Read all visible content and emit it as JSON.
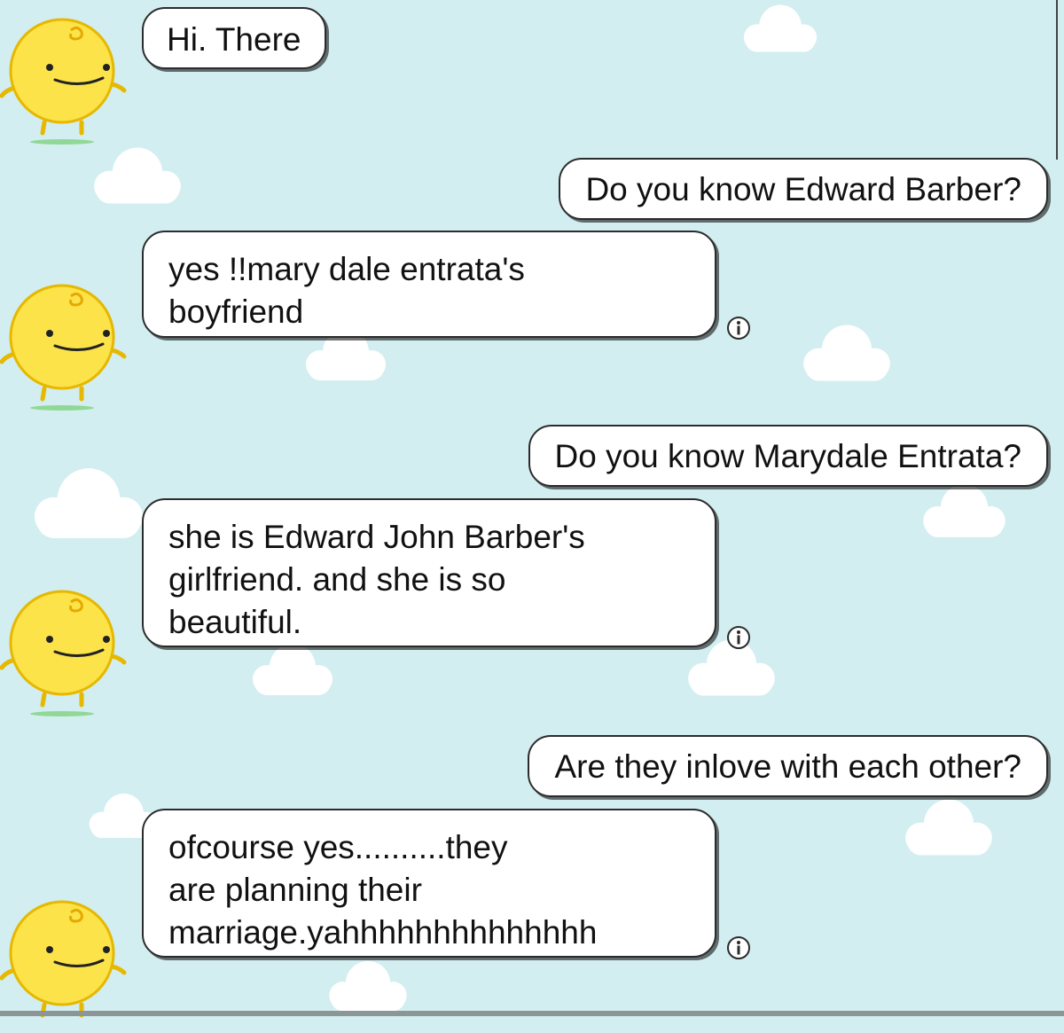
{
  "conversation": {
    "messages": [
      {
        "sender": "bot",
        "text": "Hi. There"
      },
      {
        "sender": "user",
        "text": "Do you know Edward Barber?"
      },
      {
        "sender": "bot",
        "text": "yes !!mary dale entrata's\nboyfriend"
      },
      {
        "sender": "user",
        "text": "Do you know Marydale Entrata?"
      },
      {
        "sender": "bot",
        "text": "she is Edward John Barber's\ngirlfriend. and she is so\nbeautiful."
      },
      {
        "sender": "user",
        "text": "Are they inlove with each other?"
      },
      {
        "sender": "bot",
        "text": "ofcourse  yes..........they\nare planning their\nmarriage.yahhhhhhhhhhhhhh"
      }
    ]
  },
  "icons": {
    "info": "info-icon",
    "avatar": "simsimi-avatar",
    "background": "cloud-pattern"
  },
  "colors": {
    "background": "#d3eef0",
    "cloud": "#ffffff",
    "bubble": "#ffffff",
    "bubble_border": "#2b2b2b",
    "avatar": "#fce34a",
    "avatar_outline": "#e6b800"
  }
}
